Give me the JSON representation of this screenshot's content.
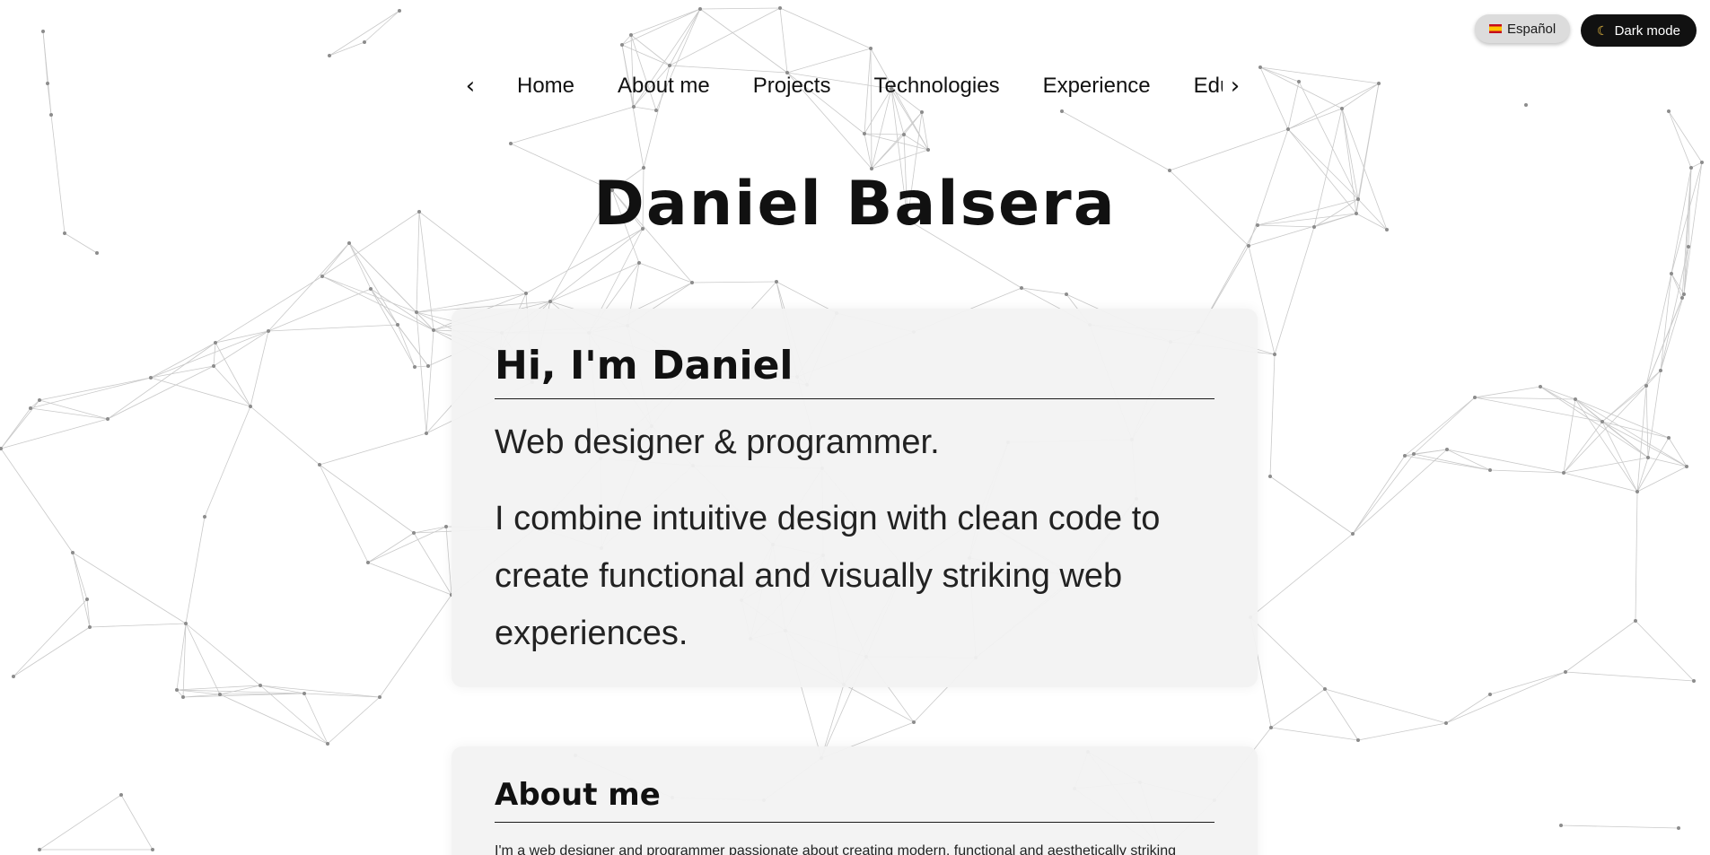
{
  "controls": {
    "language_label": "Español",
    "dark_mode_label": "Dark mode"
  },
  "nav": {
    "prev_icon": "chevron-left-icon",
    "next_icon": "chevron-right-icon",
    "items": [
      "Home",
      "About me",
      "Projects",
      "Technologies",
      "Experience",
      "Edu"
    ]
  },
  "header": {
    "title": "Daniel Balsera"
  },
  "hero": {
    "heading": "Hi, I'm Daniel",
    "subtitle": "Web designer & programmer.",
    "description": "I combine intuitive design with clean code to create functional and visually striking web experiences."
  },
  "about": {
    "heading": "About me",
    "text": "I'm a web designer and programmer passionate about creating modern, functional and aesthetically striking"
  },
  "colors": {
    "background": "#ffffff",
    "card": "#f2f2f2",
    "text": "#111111",
    "dark_button": "#111111",
    "lang_button": "#dcdcdc"
  }
}
